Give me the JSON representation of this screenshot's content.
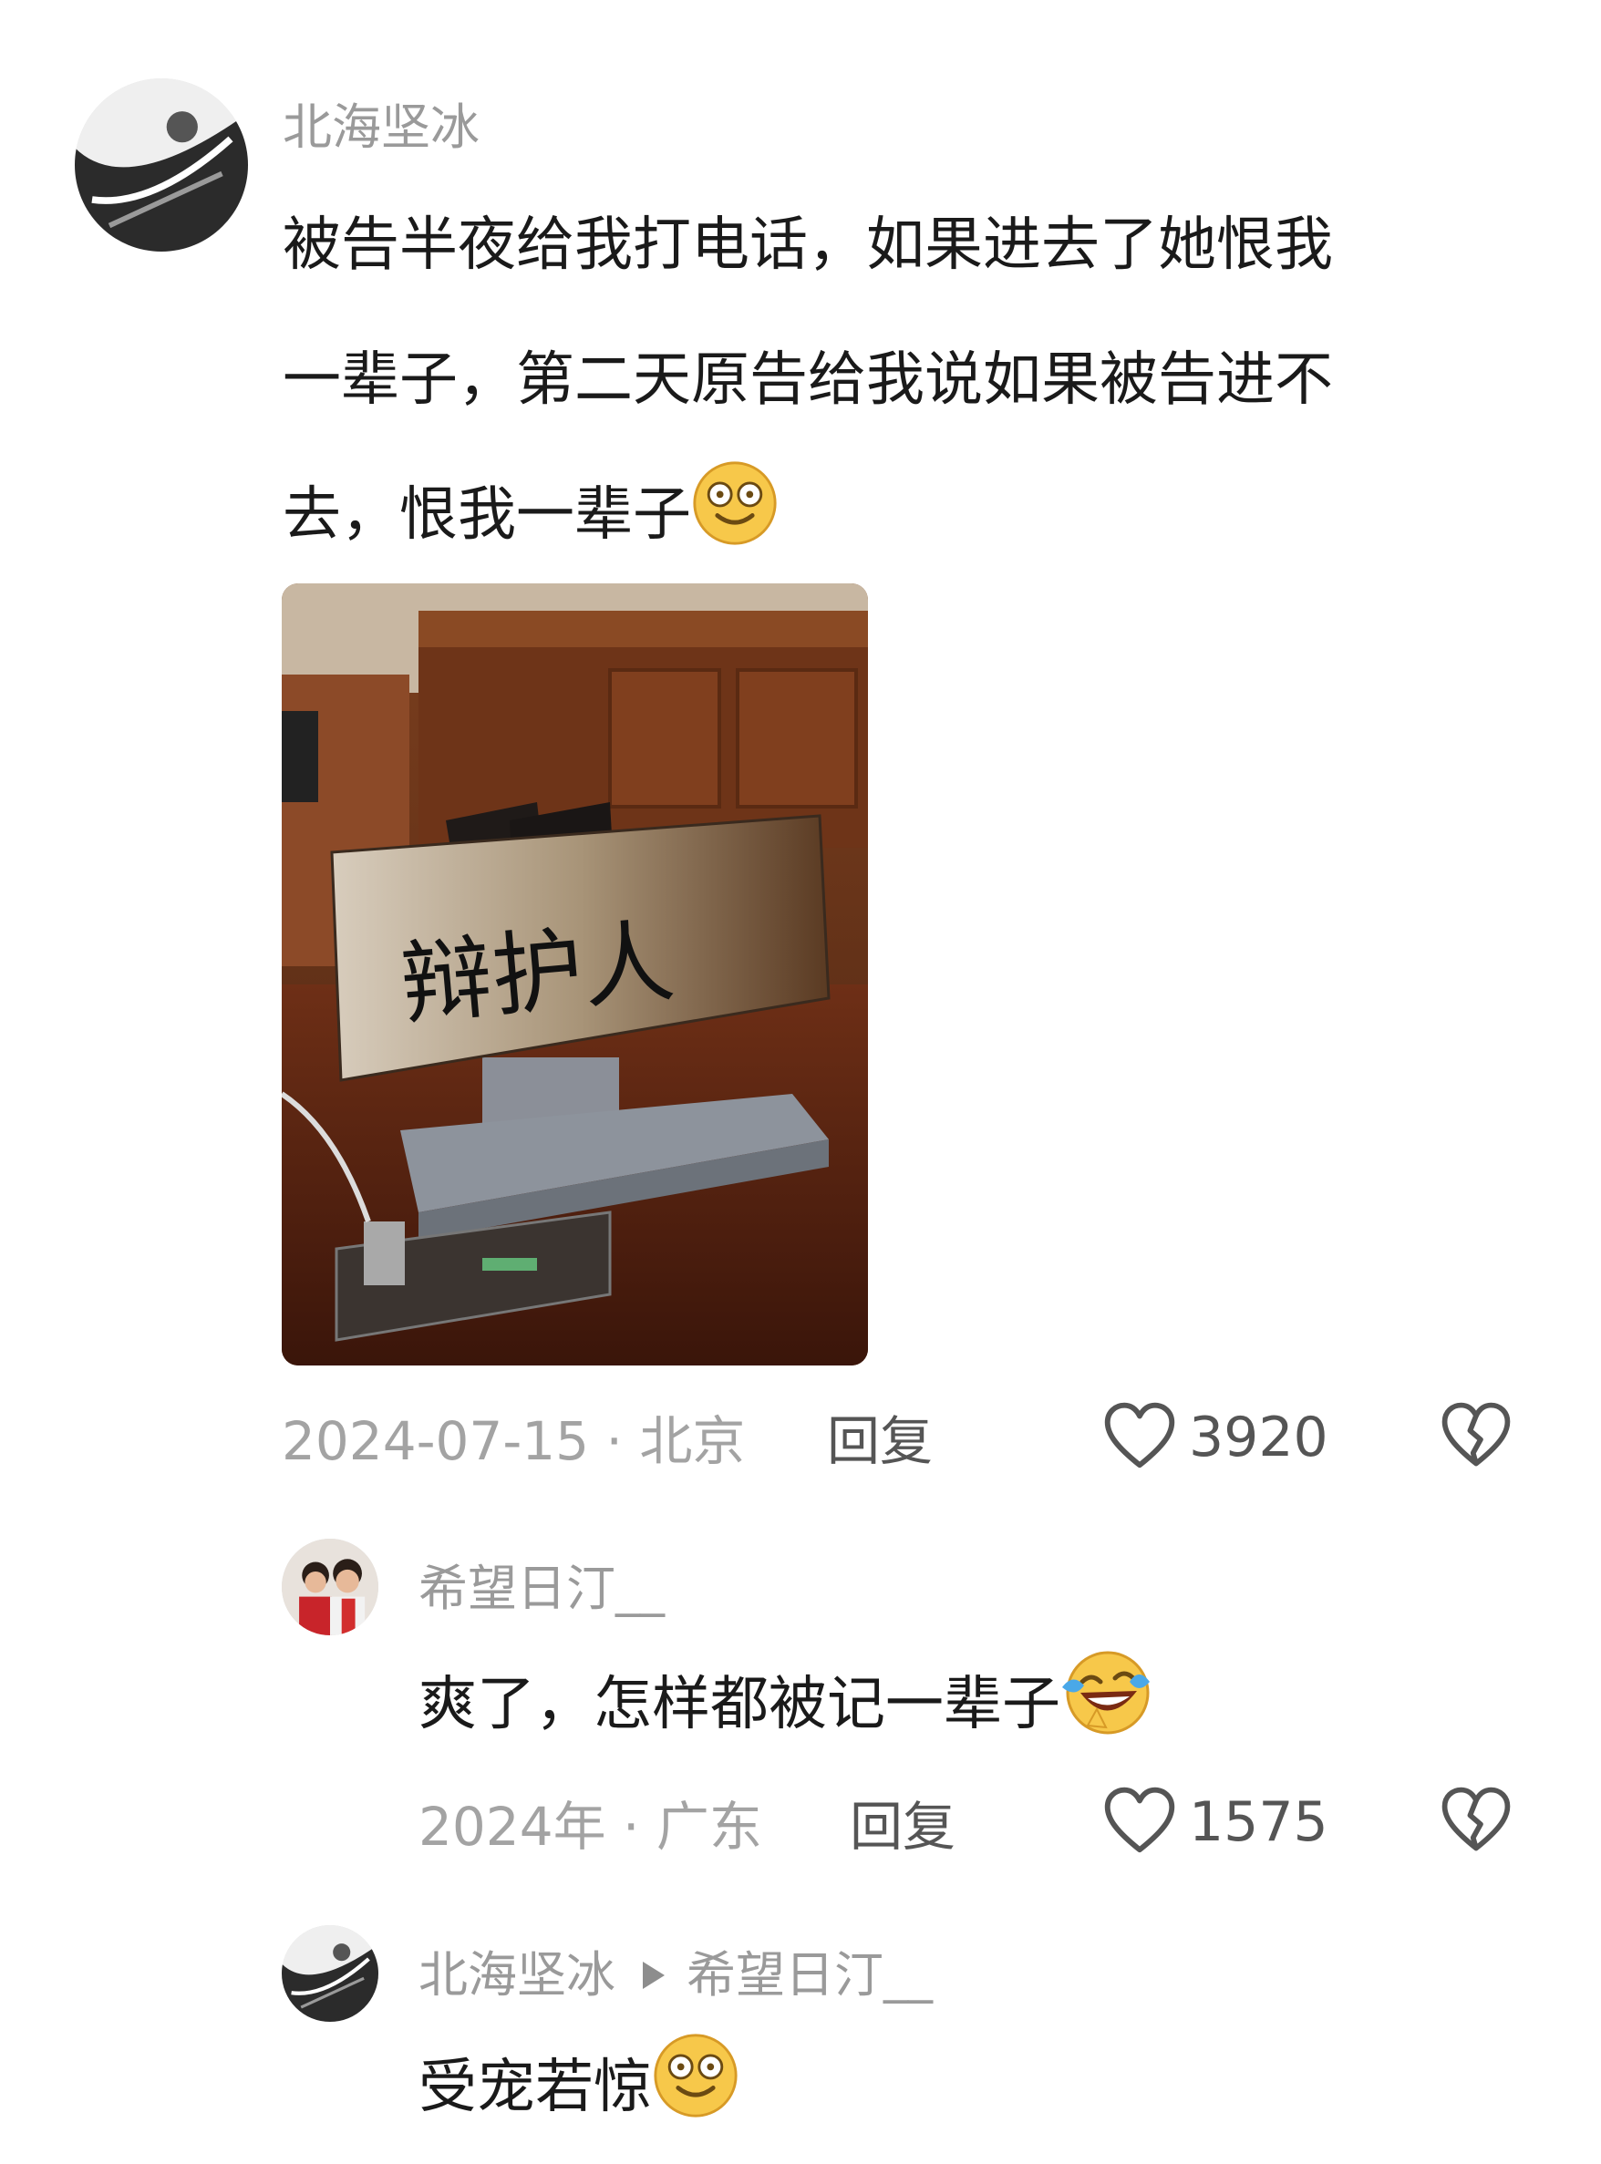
{
  "comments": [
    {
      "username": "北海坚冰",
      "text_lines": [
        "被告半夜给我打电话，如果进去了她恨我",
        "一辈子，第二天原告给我说如果被告进不",
        "去，恨我一辈子"
      ],
      "emoji": "dizzy-smile-emoji",
      "image": {
        "sign_text": "辩护人"
      },
      "date": "2024-07-15 · 北京",
      "reply_label": "回复",
      "likes": "3920"
    },
    {
      "username": "希望日汀__",
      "text": "爽了，怎样都被记一辈子",
      "emoji": "laughing-tears-emoji",
      "date": "2024年 · 广东",
      "reply_label": "回复",
      "likes": "1575"
    },
    {
      "username": "北海坚冰",
      "reply_to": "希望日汀__",
      "text": "受宠若惊",
      "emoji": "dizzy-smile-emoji"
    }
  ],
  "icons": {
    "like": "heart-outline-icon",
    "dislike": "broken-heart-icon",
    "reply_arrow": "triangle-right-icon"
  },
  "colors": {
    "username": "#9a9a9a",
    "text": "#1a1a1a",
    "meta": "#a3a3a3",
    "emoji_face": "#f7c84a"
  }
}
